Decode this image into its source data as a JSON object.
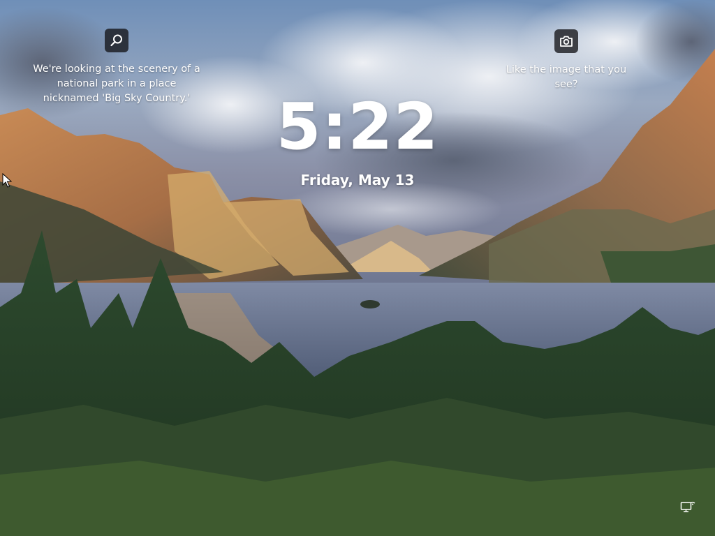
{
  "lockscreen": {
    "time": "5:22",
    "date": "Friday, May 13",
    "spotlight_fact": {
      "icon": "search-icon",
      "text": "We're looking at the scenery of a national park in a place nicknamed 'Big Sky Country.'"
    },
    "spotlight_like": {
      "icon": "camera-icon",
      "text": "Like the image that you see?"
    },
    "network_icon": "network-icon",
    "cursor_icon": "pointer-cursor-icon"
  }
}
